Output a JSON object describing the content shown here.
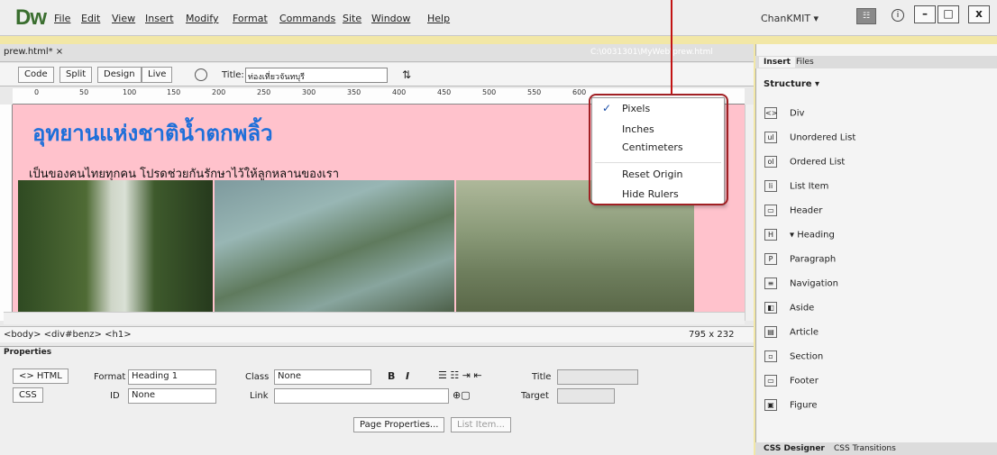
{
  "app": {
    "logo": "Dw"
  },
  "menu": [
    "File",
    "Edit",
    "View",
    "Insert",
    "Modify",
    "Format",
    "Commands",
    "Site",
    "Window",
    "Help"
  ],
  "account": {
    "user": "ChanKMIT ▾",
    "sync_label": "☷",
    "info_label": "i"
  },
  "window_buttons": {
    "minimize": "–",
    "maximize": "□",
    "close": "x"
  },
  "document": {
    "tab": "prew.html* ×",
    "path": "C:\\0031301\\MyWeb\\prew.html",
    "views": [
      "Code",
      "Split",
      "Design",
      "Live"
    ],
    "title_label": "Title:",
    "title_value": "ท่องเที่ยวจันทบุรี",
    "ruler_ticks": [
      "0",
      "50",
      "100",
      "150",
      "200",
      "250",
      "300",
      "350",
      "400",
      "450",
      "500",
      "550",
      "600"
    ],
    "heading": "อุทยานแห่งชาติน้ำตกพลิ้ว",
    "subtext": "เป็นของคนไทยทุกคน โปรดช่วยกันรักษาไว้ให้ลูกหลานของเรา",
    "tag_path": "<body> <div#benz> <h1>",
    "size": "795 x 232"
  },
  "context_menu": {
    "checked": "✓",
    "items": [
      "Pixels",
      "Inches",
      "Centimeters",
      "Reset Origin",
      "Hide Rulers"
    ]
  },
  "properties": {
    "title": "Properties",
    "html_btn": "<> HTML",
    "css_btn": "CSS",
    "format_label": "Format",
    "format_value": "Heading 1",
    "class_label": "Class",
    "class_value": "None",
    "id_label": "ID",
    "id_value": "None",
    "link_label": "Link",
    "title_label": "Title",
    "target_label": "Target",
    "bold": "B",
    "italic": "I",
    "page_props": "Page Properties...",
    "list_item": "List Item..."
  },
  "right_panel": {
    "tabs": [
      "Insert",
      "Files"
    ],
    "category": "Structure ▾",
    "items": [
      {
        "icon": "<>",
        "label": "Div"
      },
      {
        "icon": "ul",
        "label": "Unordered List"
      },
      {
        "icon": "ol",
        "label": "Ordered List"
      },
      {
        "icon": "li",
        "label": "List Item"
      },
      {
        "icon": "▭",
        "label": "Header"
      },
      {
        "icon": "H",
        "label": "▾  Heading"
      },
      {
        "icon": "P",
        "label": "Paragraph"
      },
      {
        "icon": "≡",
        "label": "Navigation"
      },
      {
        "icon": "◧",
        "label": "Aside"
      },
      {
        "icon": "▤",
        "label": "Article"
      },
      {
        "icon": "▫",
        "label": "Section"
      },
      {
        "icon": "▭",
        "label": "Footer"
      },
      {
        "icon": "▣",
        "label": "Figure"
      }
    ],
    "bottom_tabs": [
      "CSS Designer",
      "CSS Transitions"
    ]
  }
}
